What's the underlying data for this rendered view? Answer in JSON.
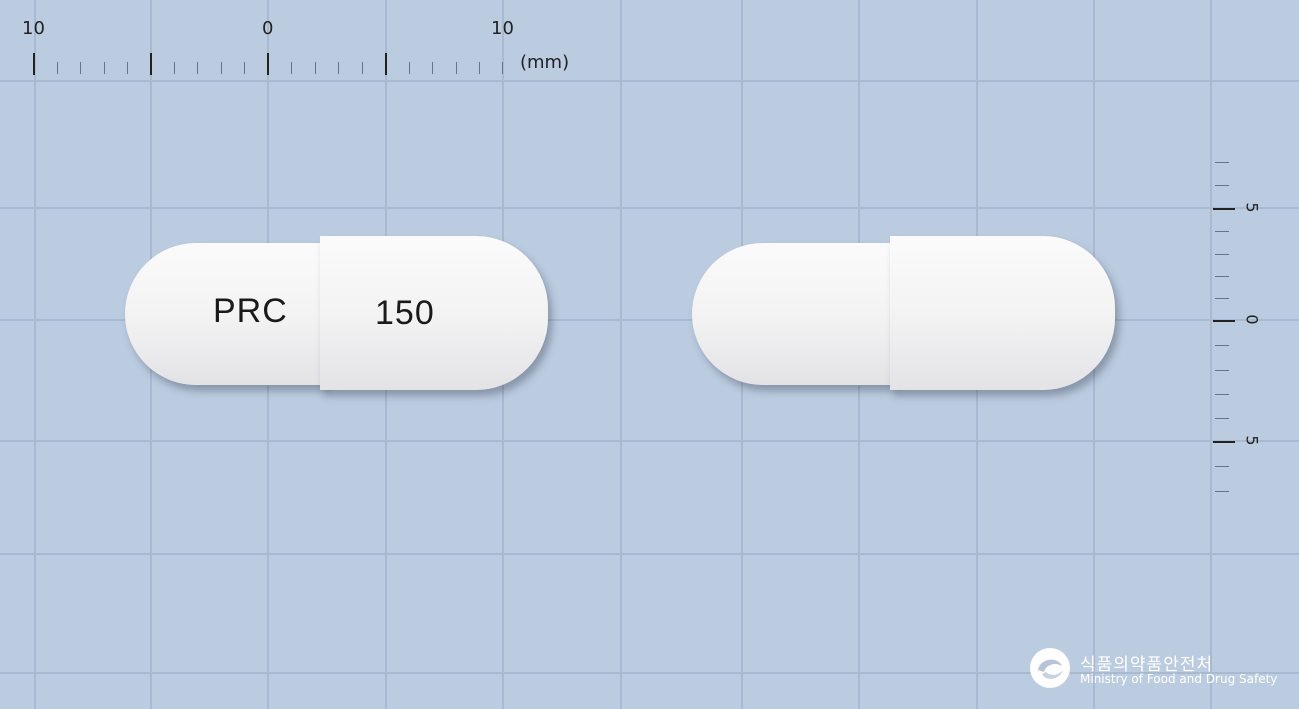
{
  "ruler": {
    "top_labels": [
      "10",
      "0",
      "10"
    ],
    "unit": "(mm)",
    "side_labels": [
      "5",
      "0",
      "5"
    ]
  },
  "capsule_front": {
    "imprint_left": "PRC",
    "imprint_right": "150",
    "color": "#f4f4f5"
  },
  "capsule_back": {
    "color": "#f4f4f5"
  },
  "watermark": {
    "name_ko": "식품의약품안전처",
    "name_en": "Ministry of Food and Drug Safety"
  },
  "colors": {
    "background": "#bccce0",
    "grid": "#a9b9cf"
  }
}
